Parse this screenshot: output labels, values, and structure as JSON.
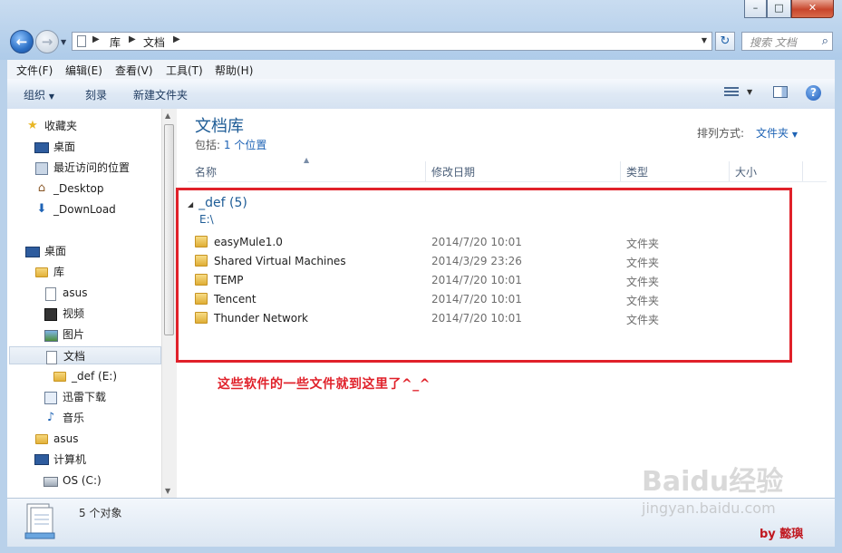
{
  "address": {
    "crumbs": [
      "库",
      "文档"
    ]
  },
  "search": {
    "placeholder": "搜索 文档"
  },
  "menu": [
    "文件(F)",
    "编辑(E)",
    "查看(V)",
    "工具(T)",
    "帮助(H)"
  ],
  "toolbar": {
    "organize": "组织",
    "burn": "刻录",
    "new_folder": "新建文件夹"
  },
  "nav": {
    "favorites": [
      {
        "label": "收藏夹",
        "icon": "star-icon"
      },
      {
        "label": "桌面",
        "icon": "desktop-icon"
      },
      {
        "label": "最近访问的位置",
        "icon": "recent-places-icon"
      },
      {
        "label": "_Desktop",
        "icon": "home-folder-icon"
      },
      {
        "label": "_DownLoad",
        "icon": "download-icon"
      }
    ],
    "tree": [
      {
        "label": "桌面",
        "icon": "desktop-icon"
      },
      {
        "label": "库",
        "icon": "library-icon"
      },
      {
        "label": "asus",
        "icon": "document-icon"
      },
      {
        "label": "视频",
        "icon": "video-icon"
      },
      {
        "label": "图片",
        "icon": "picture-icon"
      },
      {
        "label": "文档",
        "icon": "document-icon"
      },
      {
        "label": "_def (E:)",
        "icon": "folder-icon"
      },
      {
        "label": "迅雷下载",
        "icon": "library-icon"
      },
      {
        "label": "音乐",
        "icon": "music-icon"
      },
      {
        "label": "asus",
        "icon": "user-folder-icon"
      },
      {
        "label": "计算机",
        "icon": "computer-icon"
      },
      {
        "label": "OS (C:)",
        "icon": "drive-icon"
      }
    ]
  },
  "main": {
    "title": "文档库",
    "includes_prefix": "包括:",
    "includes_link": "1 个位置",
    "arrange_label": "排列方式:",
    "arrange_value": "文件夹",
    "columns": [
      "名称",
      "修改日期",
      "类型",
      "大小"
    ],
    "group_title": "_def (5)",
    "group_path": "E:\\",
    "files": [
      {
        "name": "easyMule1.0",
        "date": "2014/7/20 10:01",
        "type": "文件夹"
      },
      {
        "name": "Shared Virtual Machines",
        "date": "2014/3/29 23:26",
        "type": "文件夹"
      },
      {
        "name": "TEMP",
        "date": "2014/7/20 10:01",
        "type": "文件夹"
      },
      {
        "name": "Tencent",
        "date": "2014/7/20 10:01",
        "type": "文件夹"
      },
      {
        "name": "Thunder Network",
        "date": "2014/7/20 10:01",
        "type": "文件夹"
      }
    ],
    "annotation": "这些软件的一些文件就到这里了^_^"
  },
  "status": {
    "count": "5 个对象"
  },
  "overlay": {
    "watermark": "Baidu经验",
    "watermark_url": "jingyan.baidu.com",
    "byline": "by 懿璵"
  },
  "colors": {
    "accent": "#1e5c96",
    "annotation": "#e0212a"
  }
}
